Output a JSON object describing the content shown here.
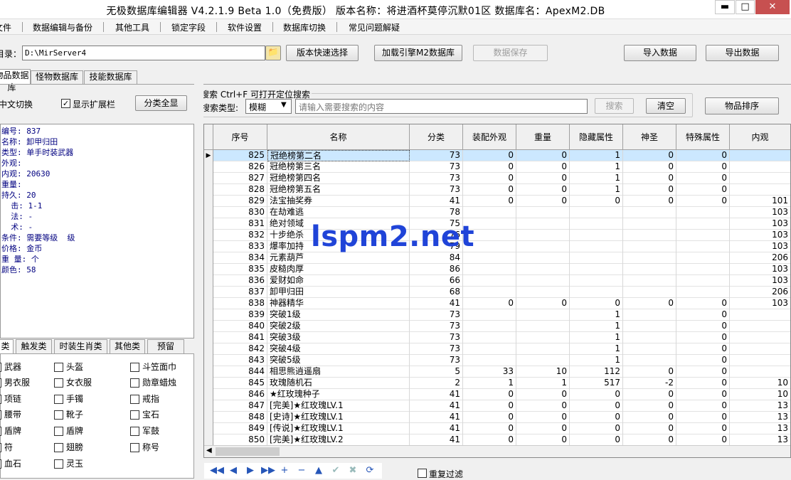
{
  "window": {
    "title": "无极数据库编辑器 V4.2.1.9    Beta 1.0（免费版）    版本名称：将进酒杯莫停沉默01区    数据库名：ApexM2.DB",
    "minimize": "▬",
    "maximize": "□",
    "close": "✕"
  },
  "menu": [
    "文件",
    "数据编辑与备份",
    "其他工具",
    "锁定字段",
    "软件设置",
    "数据库切换",
    "常见问题解疑"
  ],
  "toolbar": {
    "dir_label": "目录：",
    "dir_value": "D:\\MirServer4",
    "quick_select": "版本快速选择",
    "load_engine": "加载引擎M2数据库",
    "save_data": "数据保存",
    "import_data": "导入数据",
    "export_data": "导出数据"
  },
  "tabs": [
    "物品数据库",
    "怪物数据库",
    "技能数据库"
  ],
  "options": {
    "lang_switch": "中文切换",
    "show_ext": "显示扩展栏",
    "class_all": "分类全显"
  },
  "search": {
    "title": "搜索   Ctrl+F 可打开定位搜索",
    "type_label": "搜索类型:",
    "type_value": "模糊",
    "placeholder": "请输入需要搜索的内容",
    "search_btn": "搜索",
    "clear_btn": "清空",
    "sort_btn": "物品排序"
  },
  "info": [
    "编号: 837",
    "名称: 卸甲归田",
    "类型: 单手时装武器",
    "外观:",
    "内观: 20630",
    "重量:",
    "持久: 20",
    "  击: 1-1",
    "  法: -",
    "  术: -",
    "条件: 需要等级  级",
    "价格: 金币",
    "重 量: 个",
    "颜色: 58"
  ],
  "bottom_tabs": [
    "类",
    "触发类",
    "时装生肖类",
    "其他类",
    "预留"
  ],
  "checkboxes": [
    [
      "武器",
      "头盔",
      "斗笠面巾"
    ],
    [
      "男衣服",
      "女衣服",
      "勋章蜡烛"
    ],
    [
      "项链",
      "手镯",
      "戒指"
    ],
    [
      "腰带",
      "靴子",
      "宝石"
    ],
    [
      "盾牌",
      "盾牌",
      "军鼓"
    ],
    [
      "符",
      "翅膀",
      "称号"
    ],
    [
      "血石",
      "灵玉",
      ""
    ]
  ],
  "columns": [
    "序号",
    "名称",
    "分类",
    "装配外观",
    "重量",
    "隐藏属性",
    "神圣",
    "特殊属性",
    "内观"
  ],
  "rows": [
    [
      "825",
      "冠绝榜第二名",
      "73",
      "0",
      "0",
      "1",
      "0",
      "0",
      ""
    ],
    [
      "826",
      "冠绝榜第三名",
      "73",
      "0",
      "0",
      "1",
      "0",
      "0",
      ""
    ],
    [
      "827",
      "冠绝榜第四名",
      "73",
      "0",
      "0",
      "1",
      "0",
      "0",
      ""
    ],
    [
      "828",
      "冠绝榜第五名",
      "73",
      "0",
      "0",
      "1",
      "0",
      "0",
      ""
    ],
    [
      "829",
      "法宝抽奖券",
      "41",
      "0",
      "0",
      "0",
      "0",
      "0",
      "101"
    ],
    [
      "830",
      "在劫难逃",
      "78",
      "",
      "",
      "",
      "",
      "",
      "103"
    ],
    [
      "831",
      "绝对领域",
      "75",
      "",
      "",
      "",
      "",
      "",
      "103"
    ],
    [
      "832",
      "十步绝杀",
      "76",
      "",
      "",
      "",
      "",
      "",
      "103"
    ],
    [
      "833",
      "爆率加持",
      "79",
      "",
      "",
      "",
      "",
      "",
      "103"
    ],
    [
      "834",
      "元素葫芦",
      "84",
      "",
      "",
      "",
      "",
      "",
      "206"
    ],
    [
      "835",
      "皮糙肉厚",
      "86",
      "",
      "",
      "",
      "",
      "",
      "103"
    ],
    [
      "836",
      "爱财如命",
      "66",
      "",
      "",
      "",
      "",
      "",
      "103"
    ],
    [
      "837",
      "卸甲归田",
      "68",
      "",
      "",
      "",
      "",
      "",
      "206"
    ],
    [
      "838",
      "神器精华",
      "41",
      "0",
      "0",
      "0",
      "0",
      "0",
      "103"
    ],
    [
      "839",
      "突破1级",
      "73",
      "",
      "",
      "1",
      "",
      "0",
      ""
    ],
    [
      "840",
      "突破2级",
      "73",
      "",
      "",
      "1",
      "",
      "0",
      ""
    ],
    [
      "841",
      "突破3级",
      "73",
      "",
      "",
      "1",
      "",
      "0",
      ""
    ],
    [
      "842",
      "突破4级",
      "73",
      "",
      "",
      "1",
      "",
      "0",
      ""
    ],
    [
      "843",
      "突破5级",
      "73",
      "",
      "",
      "1",
      "",
      "0",
      ""
    ],
    [
      "844",
      "相思熊逍遥扇",
      "5",
      "33",
      "10",
      "112",
      "0",
      "0",
      ""
    ],
    [
      "845",
      "玫瑰随机石",
      "2",
      "1",
      "1",
      "517",
      "-2",
      "0",
      "10"
    ],
    [
      "846",
      "★红玫瑰种子",
      "41",
      "0",
      "0",
      "0",
      "0",
      "0",
      "10"
    ],
    [
      "847",
      "[完美]★红玫瑰LV.1",
      "41",
      "0",
      "0",
      "0",
      "0",
      "0",
      "13"
    ],
    [
      "848",
      "[史诗]★红玫瑰LV.1",
      "41",
      "0",
      "0",
      "0",
      "0",
      "0",
      "13"
    ],
    [
      "849",
      "[传说]★红玫瑰LV.1",
      "41",
      "0",
      "0",
      "0",
      "0",
      "0",
      "13"
    ],
    [
      "850",
      "[完美]★红玫瑰LV.2",
      "41",
      "0",
      "0",
      "0",
      "0",
      "0",
      "13"
    ]
  ],
  "nav": [
    "◀◀",
    "◀",
    "▶",
    "▶▶",
    "+",
    "−",
    "▲",
    "✔",
    "✖",
    "⟳"
  ],
  "repeat_filter": "重复过滤",
  "watermark": "lspm2.net",
  "colors": {
    "selected_row": "#cce8ff",
    "info_text": "#000080",
    "watermark": "#2044d8"
  }
}
